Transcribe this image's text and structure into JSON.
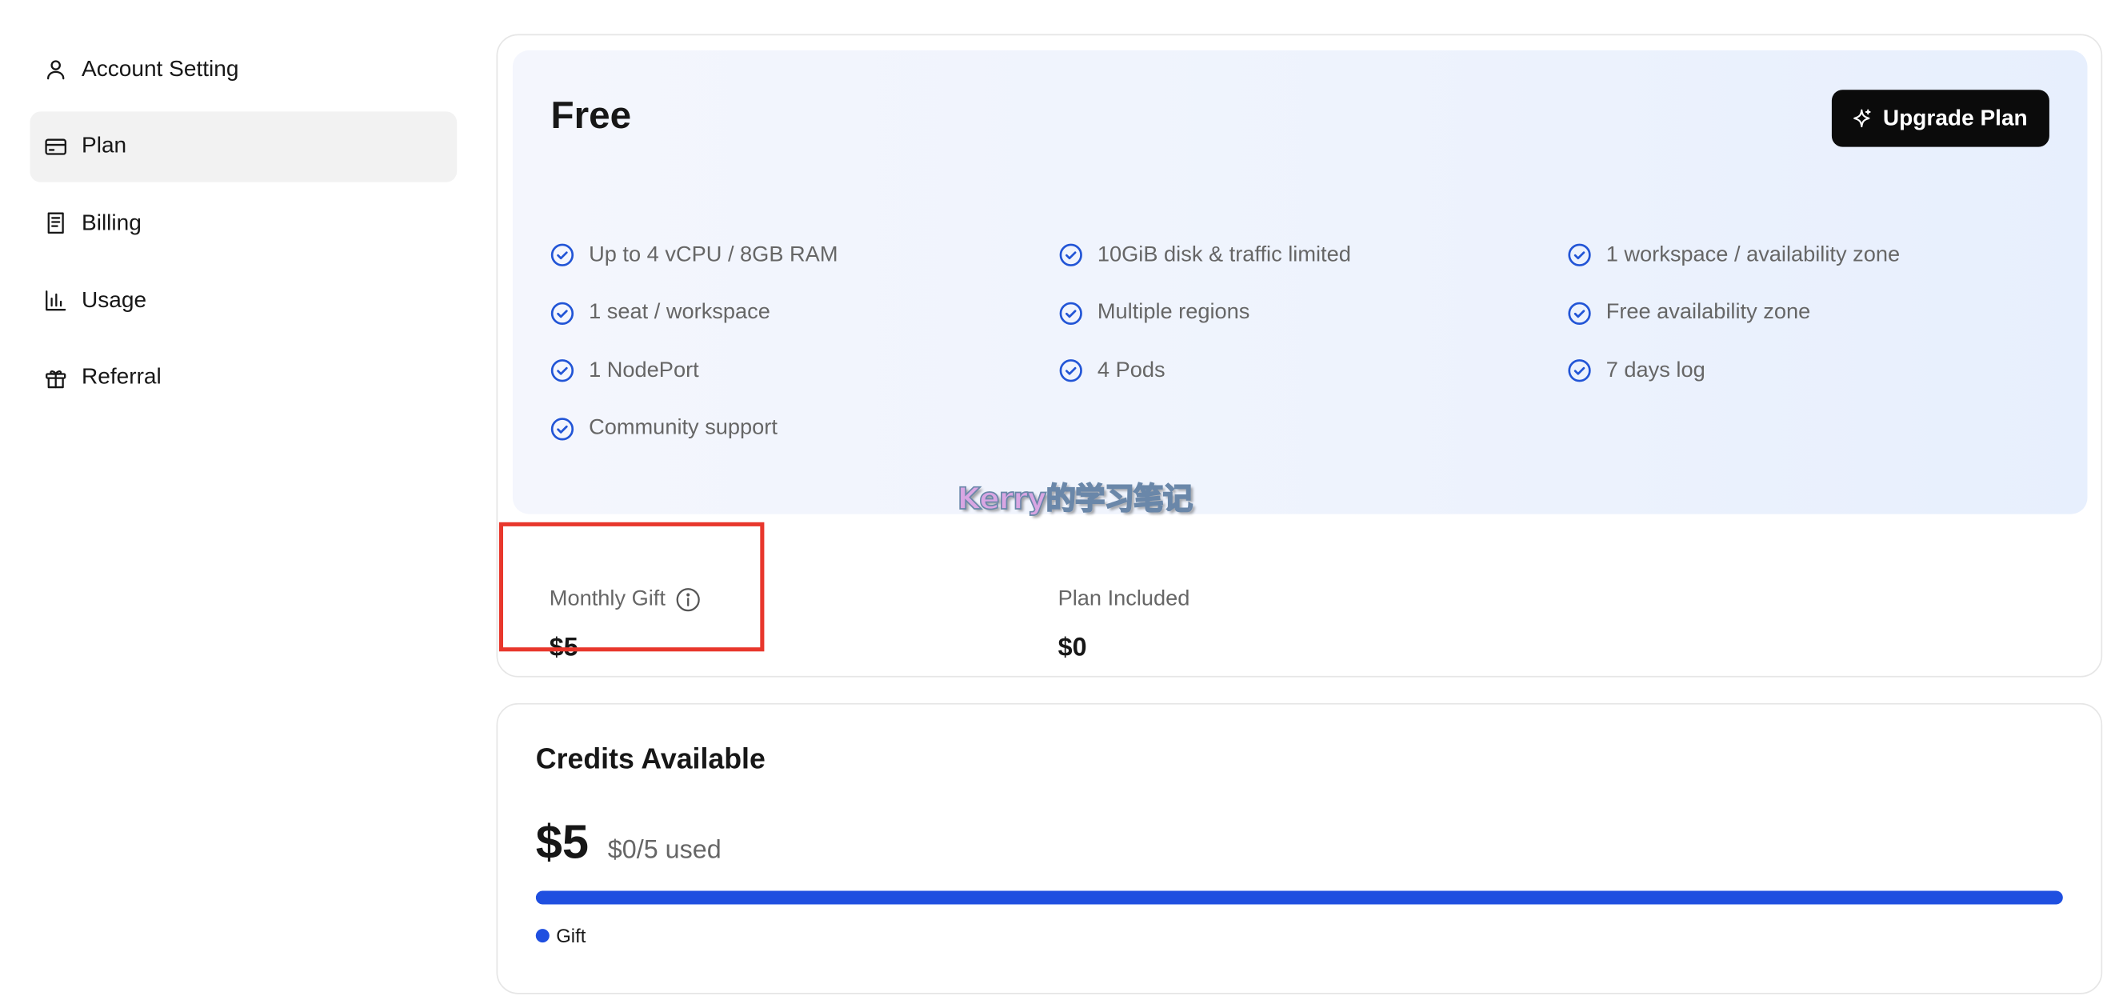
{
  "sidebar": {
    "items": [
      {
        "label": "Account Setting",
        "icon": "user-icon",
        "active": false
      },
      {
        "label": "Plan",
        "icon": "credit-card-icon",
        "active": true
      },
      {
        "label": "Billing",
        "icon": "receipt-icon",
        "active": false
      },
      {
        "label": "Usage",
        "icon": "bar-chart-icon",
        "active": false
      },
      {
        "label": "Referral",
        "icon": "gift-icon",
        "active": false
      }
    ]
  },
  "plan": {
    "name": "Free",
    "upgrade_label": "Upgrade Plan",
    "upgrade_icon": "sparkle-icon",
    "features": [
      "Up to 4 vCPU / 8GB RAM",
      "10GiB disk & traffic limited",
      "1 workspace / availability zone",
      "1 seat / workspace",
      "Multiple regions",
      "Free availability zone",
      "1 NodePort",
      "4 Pods",
      "7 days log",
      "Community support"
    ],
    "feature_icon": "check-circle-icon",
    "monthly_gift": {
      "label": "Monthly Gift",
      "value": "$5",
      "icon": "info-icon"
    },
    "plan_included": {
      "label": "Plan Included",
      "value": "$0"
    }
  },
  "watermark": "Kerry的学习笔记",
  "credits": {
    "title": "Credits Available",
    "amount": "$5",
    "used_text": "$0/5 used",
    "progress_fraction": 1.0,
    "legend_label": "Gift"
  },
  "colors": {
    "accent_blue": "#1f4fe0",
    "check_blue": "#2255d6",
    "highlight_red": "#e8372c",
    "button_dark": "#0b0b0b"
  }
}
